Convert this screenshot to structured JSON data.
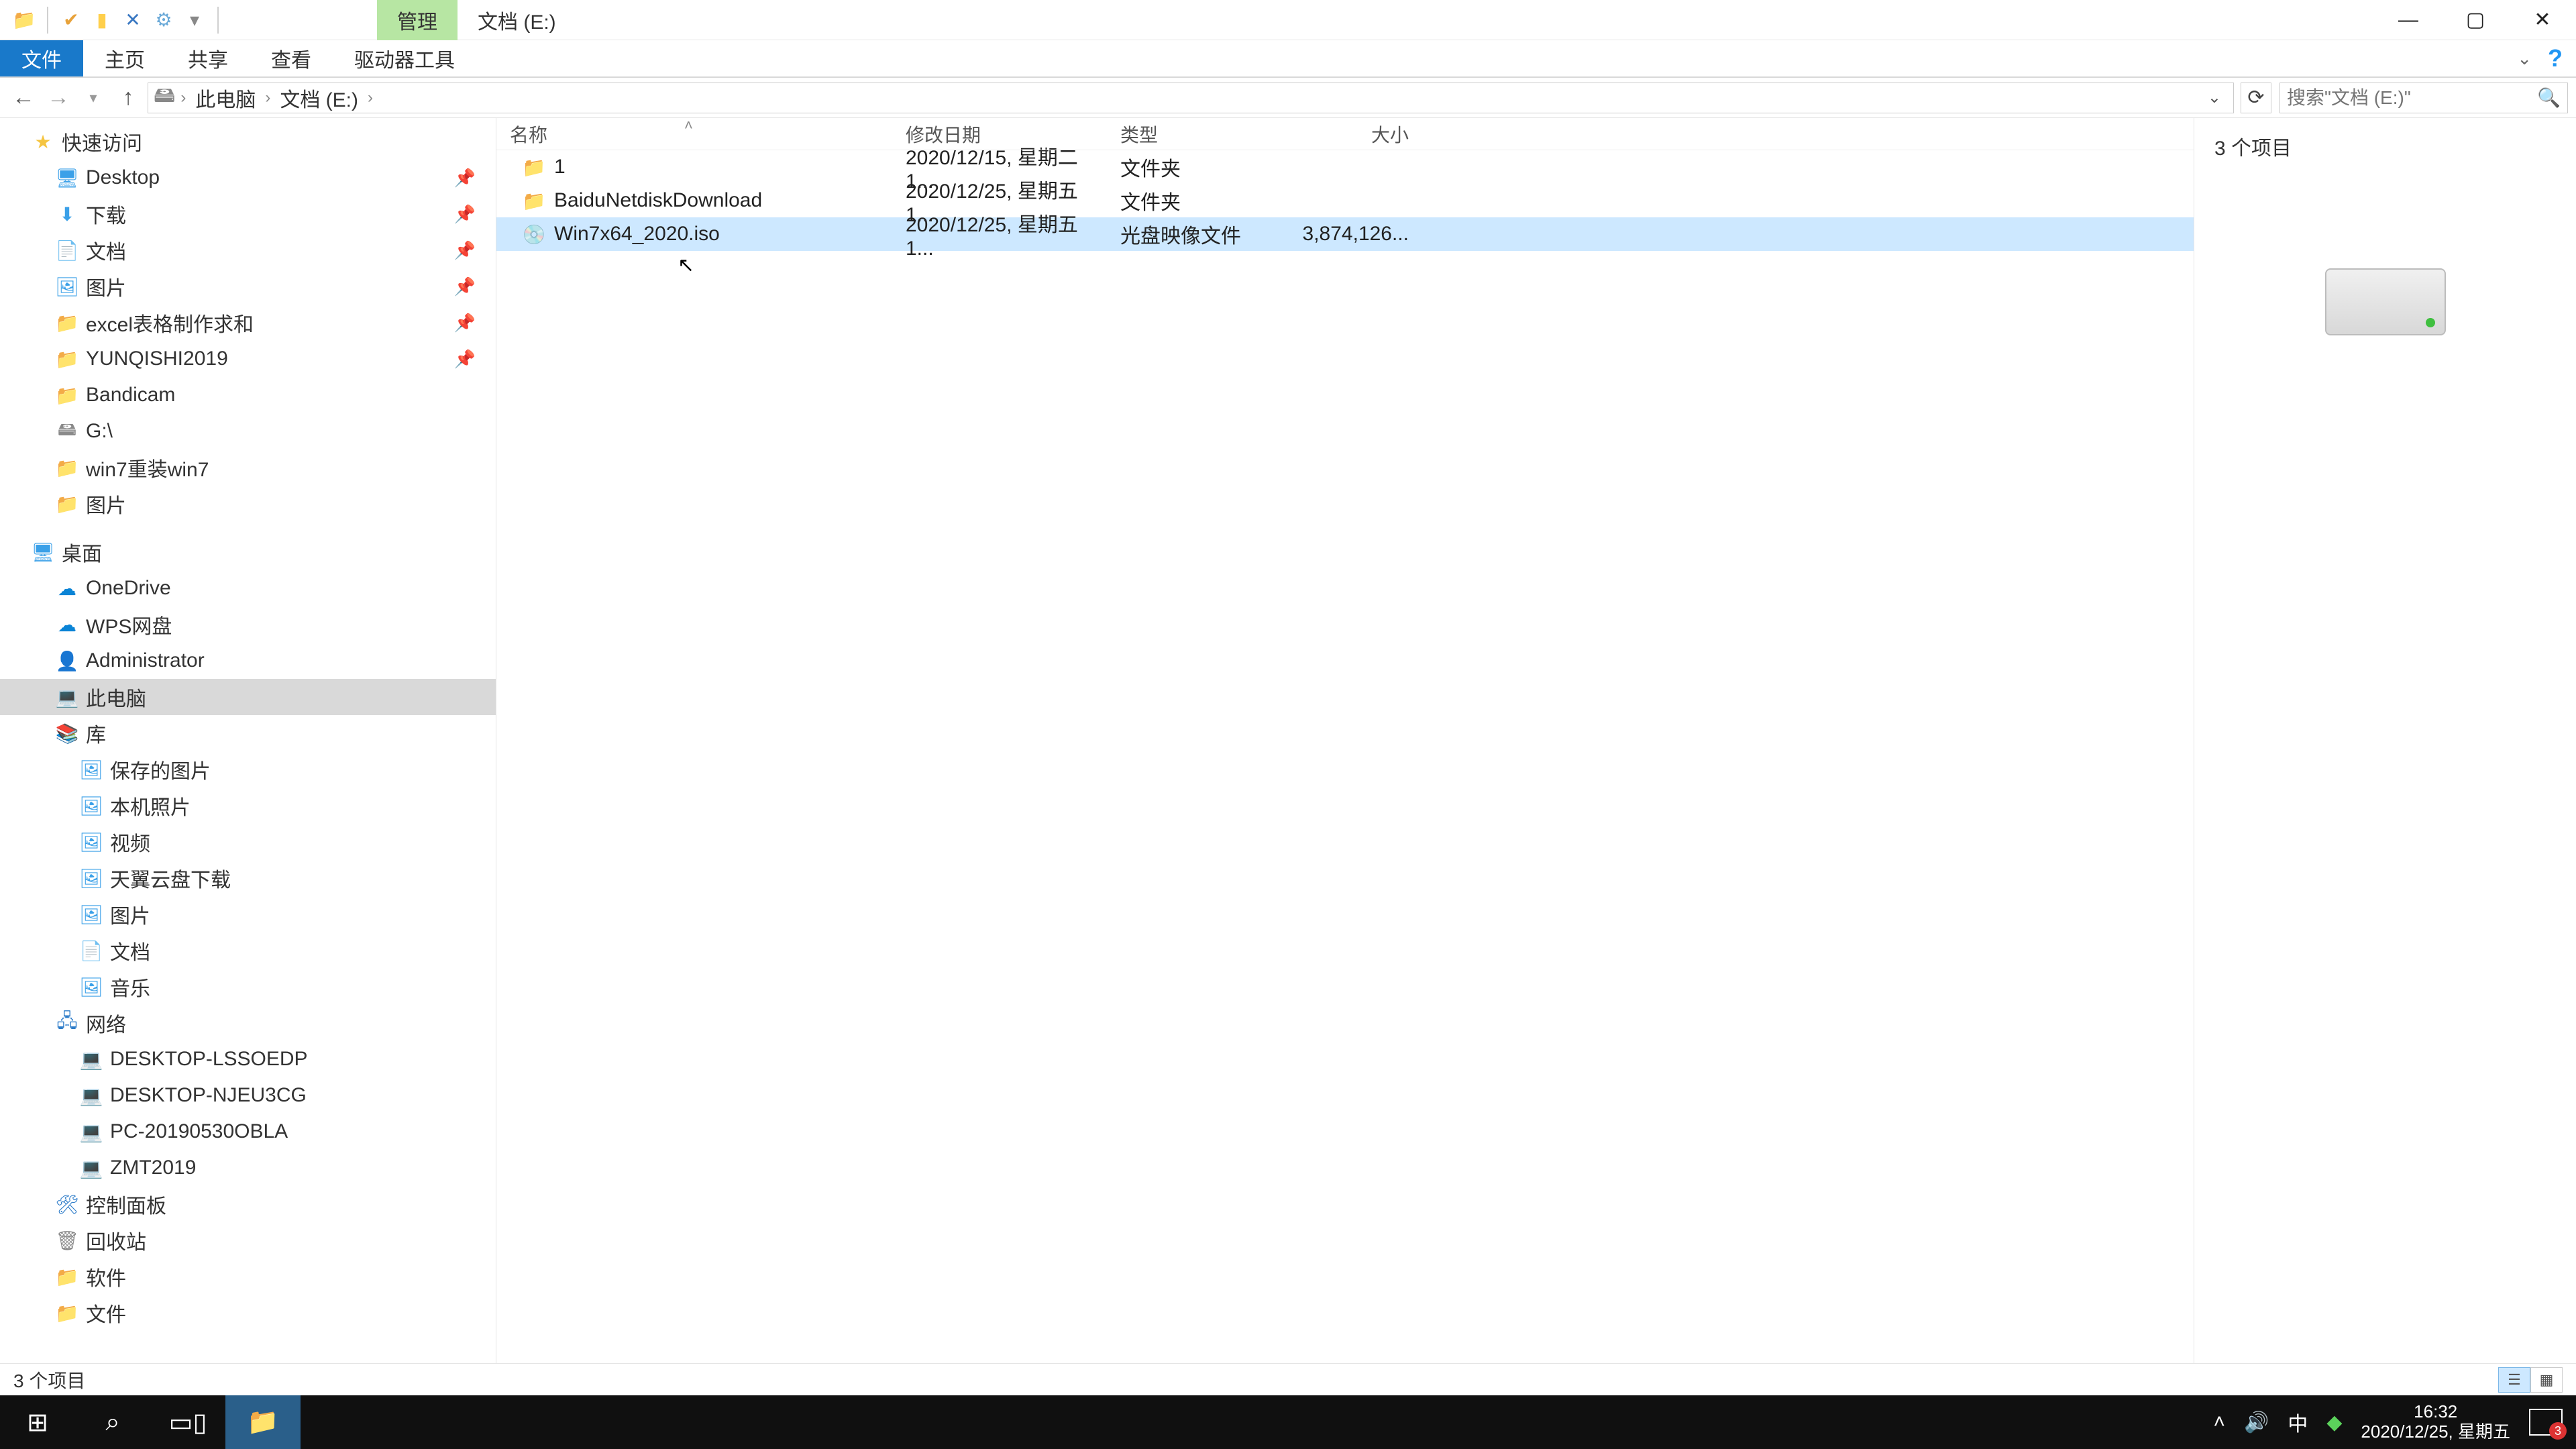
{
  "title": "文档 (E:)",
  "contextual_tab": "管理",
  "ribbon": {
    "file": "文件",
    "home": "主页",
    "share": "共享",
    "view": "查看",
    "drive": "驱动器工具"
  },
  "breadcrumb": [
    "此电脑",
    "文档 (E:)"
  ],
  "search_placeholder": "搜索\"文档 (E:)\"",
  "columns": {
    "name": "名称",
    "date": "修改日期",
    "type": "类型",
    "size": "大小"
  },
  "rows": [
    {
      "name": "1",
      "date": "2020/12/15, 星期二 1...",
      "type": "文件夹",
      "size": "",
      "icon": "folder",
      "selected": false
    },
    {
      "name": "BaiduNetdiskDownload",
      "date": "2020/12/25, 星期五 1...",
      "type": "文件夹",
      "size": "",
      "icon": "folder",
      "selected": false
    },
    {
      "name": "Win7x64_2020.iso",
      "date": "2020/12/25, 星期五 1...",
      "type": "光盘映像文件",
      "size": "3,874,126...",
      "icon": "iso",
      "selected": true
    }
  ],
  "nav": {
    "quick": "快速访问",
    "quick_items": [
      {
        "label": "Desktop",
        "icon": "desktop",
        "pinned": true
      },
      {
        "label": "下载",
        "icon": "down",
        "pinned": true
      },
      {
        "label": "文档",
        "icon": "doc",
        "pinned": true
      },
      {
        "label": "图片",
        "icon": "pic",
        "pinned": true
      },
      {
        "label": "excel表格制作求和",
        "icon": "folder",
        "pinned": true
      },
      {
        "label": "YUNQISHI2019",
        "icon": "folder",
        "pinned": true
      },
      {
        "label": "Bandicam",
        "icon": "folder",
        "pinned": false
      },
      {
        "label": "G:\\",
        "icon": "drive",
        "pinned": false
      },
      {
        "label": "win7重装win7",
        "icon": "folder",
        "pinned": false
      },
      {
        "label": "图片",
        "icon": "folder",
        "pinned": false
      }
    ],
    "desktop": "桌面",
    "desktop_items": [
      {
        "label": "OneDrive",
        "icon": "onedrive"
      },
      {
        "label": "WPS网盘",
        "icon": "wps"
      },
      {
        "label": "Administrator",
        "icon": "user"
      },
      {
        "label": "此电脑",
        "icon": "pc",
        "selected": true
      },
      {
        "label": "库",
        "icon": "lib"
      }
    ],
    "lib_items": [
      {
        "label": "保存的图片",
        "icon": "pic"
      },
      {
        "label": "本机照片",
        "icon": "pic"
      },
      {
        "label": "视频",
        "icon": "pic"
      },
      {
        "label": "天翼云盘下载",
        "icon": "pic"
      },
      {
        "label": "图片",
        "icon": "pic"
      },
      {
        "label": "文档",
        "icon": "doc"
      },
      {
        "label": "音乐",
        "icon": "pic"
      }
    ],
    "network": "网络",
    "net_items": [
      {
        "label": "DESKTOP-LSSOEDP"
      },
      {
        "label": "DESKTOP-NJEU3CG"
      },
      {
        "label": "PC-20190530OBLA"
      },
      {
        "label": "ZMT2019"
      }
    ],
    "misc": [
      {
        "label": "控制面板",
        "icon": "panel"
      },
      {
        "label": "回收站",
        "icon": "recycle"
      },
      {
        "label": "软件",
        "icon": "folder"
      },
      {
        "label": "文件",
        "icon": "folder"
      }
    ]
  },
  "preview_count": "3 个项目",
  "status_text": "3 个项目",
  "clock": {
    "time": "16:32",
    "date": "2020/12/25, 星期五"
  },
  "ime": "中",
  "notif_count": "3"
}
